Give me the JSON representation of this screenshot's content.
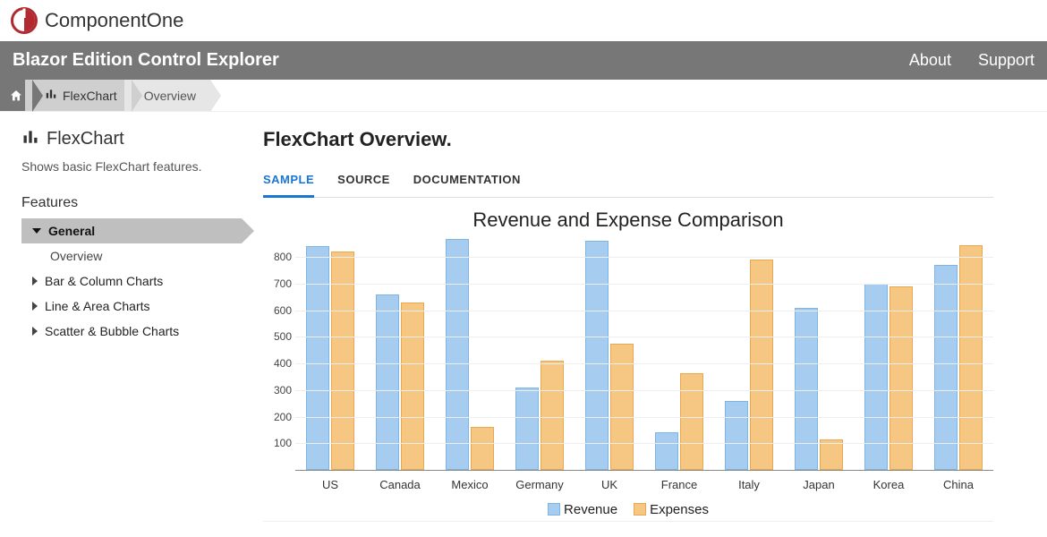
{
  "brand": {
    "name": "ComponentOne"
  },
  "titlebar": {
    "title": "Blazor Edition Control Explorer",
    "links": [
      "About",
      "Support"
    ]
  },
  "breadcrumb": {
    "items": [
      "FlexChart",
      "Overview"
    ]
  },
  "sidebar": {
    "title": "FlexChart",
    "desc": "Shows basic FlexChart features.",
    "features_heading": "Features",
    "items": [
      {
        "label": "General",
        "selected": true
      },
      {
        "label": "Overview",
        "sub": true
      },
      {
        "label": "Bar & Column Charts"
      },
      {
        "label": "Line & Area Charts"
      },
      {
        "label": "Scatter & Bubble Charts"
      }
    ]
  },
  "main": {
    "title": "FlexChart Overview.",
    "tabs": [
      {
        "label": "SAMPLE",
        "active": true
      },
      {
        "label": "SOURCE"
      },
      {
        "label": "DOCUMENTATION"
      }
    ]
  },
  "chart_data": {
    "type": "bar",
    "title": "Revenue and Expense Comparison",
    "categories": [
      "US",
      "Canada",
      "Mexico",
      "Germany",
      "UK",
      "France",
      "Italy",
      "Japan",
      "Korea",
      "China"
    ],
    "series": [
      {
        "name": "Revenue",
        "values": [
          840,
          660,
          870,
          310,
          860,
          140,
          260,
          610,
          700,
          770
        ]
      },
      {
        "name": "Expenses",
        "values": [
          820,
          630,
          160,
          410,
          475,
          365,
          790,
          115,
          690,
          845
        ]
      }
    ],
    "ylim": [
      0,
      875
    ],
    "yticks": [
      100,
      200,
      300,
      400,
      500,
      600,
      700,
      800
    ],
    "xlabel": "",
    "ylabel": ""
  }
}
